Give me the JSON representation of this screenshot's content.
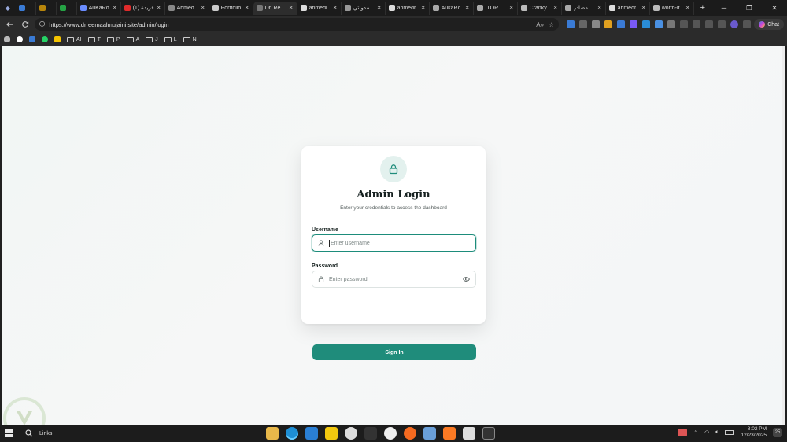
{
  "browser": {
    "tabs": [
      {
        "label": "",
        "color": "#3a7bd5",
        "active": false
      },
      {
        "label": "",
        "color": "#b8860b",
        "active": false
      },
      {
        "label": "",
        "color": "#25a244",
        "active": false
      },
      {
        "label": "AuKaRo",
        "color": "#6a8cff",
        "active": false
      },
      {
        "label": "(1) فريدة",
        "color": "#e02b2b",
        "active": false
      },
      {
        "label": "Ahmed",
        "color": "#888888",
        "active": false
      },
      {
        "label": "Portfolio",
        "color": "#cccccc",
        "active": false
      },
      {
        "label": "Dr. Reem",
        "color": "#777777",
        "active": true
      },
      {
        "label": "ahmedr",
        "color": "#dddddd",
        "active": false
      },
      {
        "label": "مدونتي",
        "color": "#999999",
        "active": false
      },
      {
        "label": "ahmedr",
        "color": "#dddddd",
        "active": false
      },
      {
        "label": "AukaRo",
        "color": "#aaaaaa",
        "active": false
      },
      {
        "label": "ITOR - Li",
        "color": "#aaaaaa",
        "active": false
      },
      {
        "label": "Cranky",
        "color": "#bbbbbb",
        "active": false
      },
      {
        "label": "مصادر",
        "color": "#aaaaaa",
        "active": false
      },
      {
        "label": "ahmedr",
        "color": "#dddddd",
        "active": false
      },
      {
        "label": "worth-it",
        "color": "#bbbbbb",
        "active": false
      }
    ],
    "url": "https://www.drreemaalmujaini.site/admin/login",
    "copilot_label": "Chat",
    "bookmarks": [
      {
        "label": "AI",
        "type": "folder"
      },
      {
        "label": "T",
        "type": "folder"
      },
      {
        "label": "P",
        "type": "folder"
      },
      {
        "label": "A",
        "type": "folder"
      },
      {
        "label": "J",
        "type": "folder"
      },
      {
        "label": "L",
        "type": "folder"
      },
      {
        "label": "N",
        "type": "folder"
      }
    ]
  },
  "login": {
    "title": "Admin Login",
    "subtitle": "Enter your credentials to access the dashboard",
    "username_label": "Username",
    "username_placeholder": "Enter username",
    "password_label": "Password",
    "password_placeholder": "Enter password",
    "submit_label": "Sign In",
    "accent_color": "#1f8c7b"
  },
  "taskbar": {
    "search_label": "Links",
    "time": "8:02 PM",
    "date": "12/23/2025",
    "notification_count": "25"
  },
  "icons": [
    "lock-icon",
    "user-icon",
    "eye-icon",
    "back-icon",
    "refresh-icon",
    "windows-start-icon",
    "search-icon"
  ]
}
